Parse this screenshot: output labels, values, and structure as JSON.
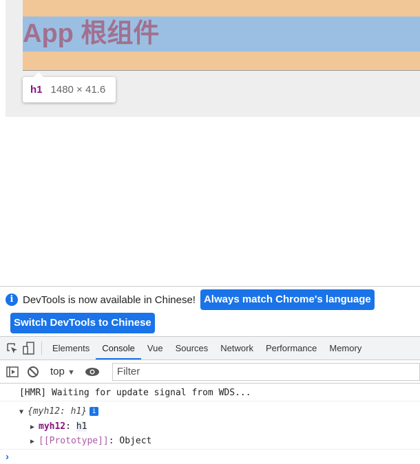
{
  "page": {
    "heading": "App 根组件",
    "tooltip_tag": "h1",
    "tooltip_size": "1480 × 41.6"
  },
  "devtools": {
    "infobar": {
      "text": "DevTools is now available in Chinese!",
      "btn_match": "Always match Chrome's language",
      "btn_switch": "Switch DevTools to Chinese"
    },
    "tabs": [
      "Elements",
      "Console",
      "Vue",
      "Sources",
      "Network",
      "Performance",
      "Memory"
    ],
    "active_tab": "Console",
    "toolbar": {
      "context": "top",
      "filter_placeholder": "Filter"
    },
    "console": {
      "hmr": "[HMR] Waiting for update signal from WDS...",
      "obj_summary": "{myh12: h1}",
      "prop_key": "myh12",
      "prop_value": "h1",
      "proto_key": "[[Prototype]]",
      "proto_value": "Object",
      "prompt": "›"
    }
  }
}
